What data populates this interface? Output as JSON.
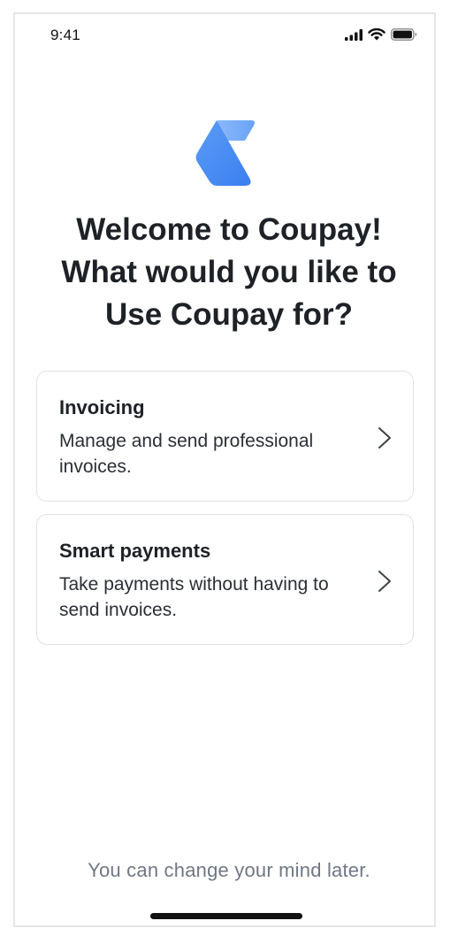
{
  "status_bar": {
    "time": "9:41"
  },
  "icons": {
    "signal": "cellular-signal-icon",
    "wifi": "wifi-icon",
    "battery": "battery-icon",
    "logo": "coupay-logo",
    "chevron": "chevron-right-icon"
  },
  "colors": {
    "brand_blue": "#4d8ff5",
    "brand_blue_light": "#7fb0f8",
    "title": "#1e2126",
    "muted": "#707784"
  },
  "heading": {
    "line1": "Welcome to Coupay!",
    "line2": "What would you like to",
    "line3": "Use Coupay for?"
  },
  "options": [
    {
      "title": "Invoicing",
      "description": "Manage and send professional invoices."
    },
    {
      "title": "Smart payments",
      "description": "Take payments without having to send invoices."
    }
  ],
  "footer": {
    "note": "You can change your mind later."
  }
}
